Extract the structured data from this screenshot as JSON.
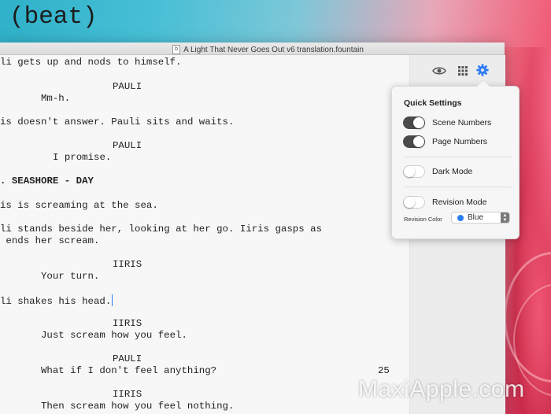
{
  "overlay": {
    "beat": "(beat)"
  },
  "window": {
    "title": "A Light That Never Goes Out v6 translation.fountain",
    "doc_icon": "b"
  },
  "script_lines": [
    "li gets up and nods to himself.",
    "PAULI",
    "Mm-h.",
    "is doesn't answer. Pauli sits and waits.",
    "PAULI",
    "I promise.",
    ". SEASHORE - DAY",
    "is is screaming at the sea.",
    "li stands beside her, looking at her go. Iiris gasps as",
    " ends her scream.",
    "IIRIS",
    "Your turn.",
    "li shakes his head.",
    "IIRIS",
    "Just scream how you feel.",
    "PAULI",
    "What if I don't feel anything?",
    "IIRIS",
    "Then scream how you feel nothing."
  ],
  "page_number": "25",
  "toolbar": {
    "preview": "eye-icon",
    "cards": "grid-icon",
    "settings": "gear-icon"
  },
  "quick_settings": {
    "title": "Quick Settings",
    "scene_numbers": {
      "label": "Scene Numbers",
      "on": true
    },
    "page_numbers": {
      "label": "Page Numbers",
      "on": true
    },
    "dark_mode": {
      "label": "Dark Mode",
      "on": false
    },
    "revision_mode": {
      "label": "Revision Mode",
      "on": false
    },
    "revision_color_label": "Revision Color",
    "revision_color_value": "Blue",
    "revision_color_hex": "#2a7ef0"
  },
  "watermark": "MaxiApple.com",
  "colors": {
    "accent": "#2f7bf5",
    "toggle_on": "#4a4a4a"
  }
}
